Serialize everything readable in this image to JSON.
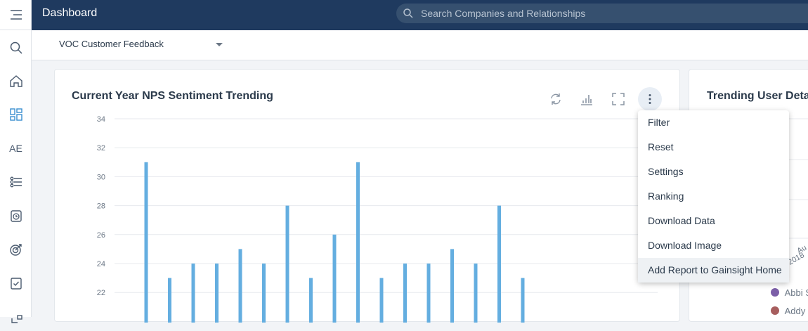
{
  "app": {
    "title": "Dashboard"
  },
  "search": {
    "placeholder": "Search Companies and Relationships"
  },
  "sidebar": {
    "items": [
      {
        "icon": "menu-icon"
      },
      {
        "icon": "search-icon"
      },
      {
        "icon": "home-icon"
      },
      {
        "icon": "dashboard-icon"
      },
      {
        "label": "AE"
      },
      {
        "icon": "timeline-icon"
      },
      {
        "icon": "timer-icon"
      },
      {
        "icon": "target-icon"
      },
      {
        "icon": "checklist-icon"
      }
    ]
  },
  "subbar": {
    "selected_dashboard": "VOC Customer Feedback"
  },
  "card1": {
    "title": "Current Year NPS Sentiment Trending",
    "tools": [
      "refresh-icon",
      "chart-type-icon",
      "fullscreen-icon",
      "more-icon"
    ]
  },
  "card2": {
    "title": "Trending User Details",
    "legend": [
      "Abbi S",
      "Addy"
    ],
    "legend_colors": [
      "#7b5ea7",
      "#a75e5e"
    ],
    "fragments": [
      "Au",
      "-2018"
    ]
  },
  "menu": {
    "items": [
      "Filter",
      "Reset",
      "Settings",
      "Ranking",
      "Download Data",
      "Download Image",
      "Add Report to Gainsight Home"
    ]
  },
  "colors": {
    "topbar": "#1f3a5f",
    "bar": "#64aee0"
  },
  "chart_data": {
    "type": "bar",
    "title": "Current Year NPS Sentiment Trending",
    "ylim": [
      20,
      34
    ],
    "yticks": [
      34,
      32,
      30,
      28,
      26,
      24,
      22
    ],
    "values": [
      31,
      23,
      24,
      24,
      25,
      24,
      28,
      23,
      26,
      31,
      23,
      24,
      24,
      25,
      24,
      28,
      23
    ]
  }
}
